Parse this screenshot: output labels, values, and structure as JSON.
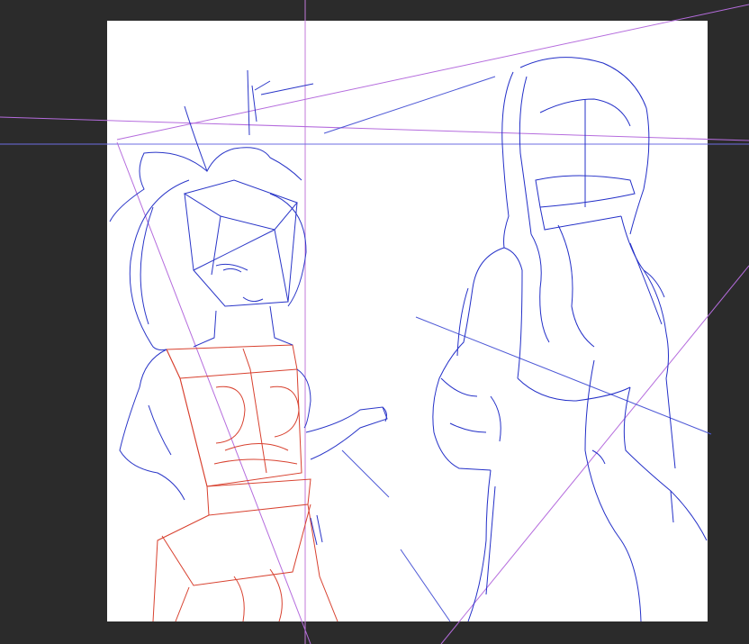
{
  "app": {
    "view": "drawing-canvas",
    "background_color": "#2b2b2b",
    "canvas_color": "#ffffff"
  },
  "strokes": {
    "perspective_guide_color": "#b65cd6",
    "horizon_guide_color": "#5a5ad8",
    "sketch_blue_color": "#2430c8",
    "construction_red_color": "#d83a2a"
  }
}
